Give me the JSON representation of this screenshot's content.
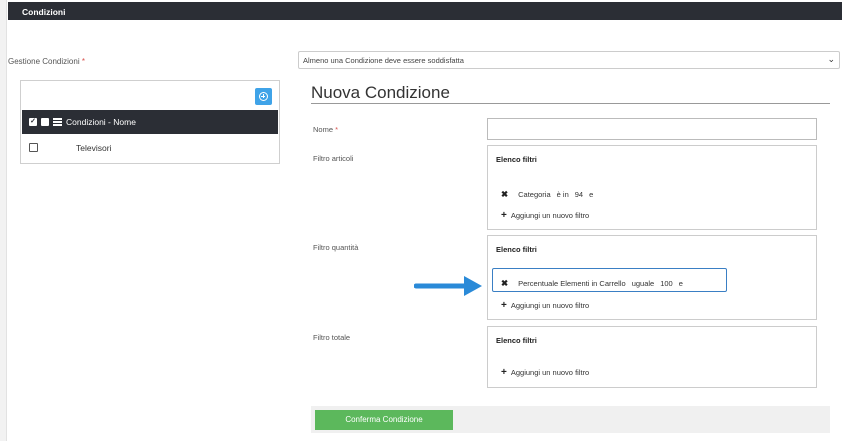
{
  "header": {
    "title": "Condizioni"
  },
  "gestione": {
    "label": "Gestione Condizioni",
    "required_mark": "*",
    "selected": "Almeno una Condizione deve essere soddisfatta"
  },
  "tree": {
    "items": [
      {
        "label": "Condizioni - Nome",
        "selected": true,
        "checked": true
      },
      {
        "label": "Televisori",
        "selected": false,
        "checked": false
      }
    ]
  },
  "form": {
    "title": "Nuova Condizione",
    "nome": {
      "label": "Nome",
      "required_mark": "*",
      "value": ""
    },
    "filtro_articoli": {
      "label": "Filtro articoli",
      "header": "Elenco filtri",
      "items": [
        {
          "field": "Categoria",
          "operator": "è in",
          "value": "94",
          "conj": "e"
        }
      ],
      "add_label": "Aggiungi un nuovo filtro"
    },
    "filtro_quantita": {
      "label": "Filtro quantità",
      "header": "Elenco filtri",
      "items": [
        {
          "field": "Percentuale Elementi in Carrello",
          "operator": "uguale",
          "value": "100",
          "conj": "e"
        }
      ],
      "add_label": "Aggiungi un nuovo filtro"
    },
    "filtro_totale": {
      "label": "Filtro totale",
      "header": "Elenco filtri",
      "items": [],
      "add_label": "Aggiungi un nuovo filtro"
    },
    "confirm_label": "Conferma Condizione"
  },
  "colors": {
    "header_bg": "#2b2e35",
    "accent_blue": "#3fa3e8",
    "highlight_border": "#3a7fc4",
    "arrow": "#2a8ad8",
    "confirm_green": "#5cb85c",
    "required": "#d9534f"
  }
}
